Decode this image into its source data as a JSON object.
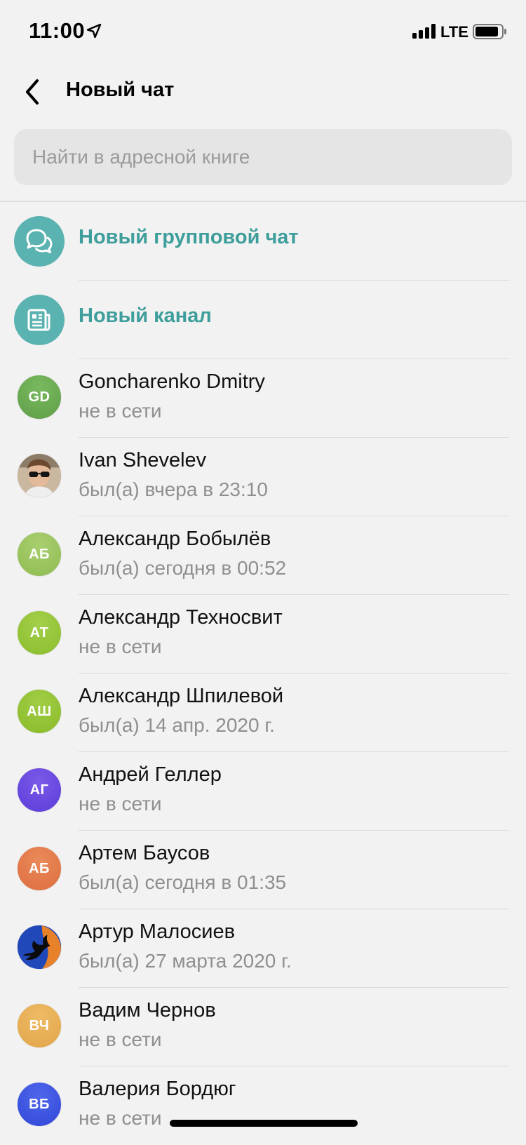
{
  "status_bar": {
    "time": "11:00",
    "network": "LTE",
    "icons": [
      "location-arrow-icon",
      "signal-icon",
      "battery-icon"
    ]
  },
  "nav": {
    "back_icon": "chevron-left-icon",
    "title": "Новый чат"
  },
  "search": {
    "placeholder": "Найти в адресной книге",
    "value": ""
  },
  "actions": [
    {
      "label": "Новый групповой чат",
      "icon": "chat-bubbles-icon"
    },
    {
      "label": "Новый канал",
      "icon": "newspaper-icon"
    }
  ],
  "contacts": [
    {
      "name": "Goncharenko Dmitry",
      "status": "не в сети",
      "initials": "GD",
      "color": "#5f9e47",
      "color2": "#79b95f"
    },
    {
      "name": "Ivan Shevelev",
      "status": "был(а) вчера в 23:10",
      "initials": "",
      "photo": true
    },
    {
      "name": "Александр Бобылёв",
      "status": "был(а) сегодня в 00:52",
      "initials": "АБ",
      "color": "#8fbb52",
      "color2": "#a9cf6f"
    },
    {
      "name": "Александр Техносвит",
      "status": "не в сети",
      "initials": "АТ",
      "color": "#8bbd2e",
      "color2": "#a3cf4a"
    },
    {
      "name": "Александр Шпилевой",
      "status": "был(а) 14 апр. 2020 г.",
      "initials": "АШ",
      "color": "#89bb2a",
      "color2": "#a1cd45"
    },
    {
      "name": "Андрей Геллер",
      "status": "не в сети",
      "initials": "АГ",
      "color": "#5b3cd8",
      "color2": "#7a5ae8"
    },
    {
      "name": "Артем Баусов",
      "status": "был(а) сегодня в 01:35",
      "initials": "АБ",
      "color": "#dd6d3f",
      "color2": "#ea8a5a"
    },
    {
      "name": "Артур Малосиев",
      "status": "был(а) 27 марта 2020 г.",
      "initials": "",
      "logo": true
    },
    {
      "name": "Вадим Чернов",
      "status": "не в сети",
      "initials": "ВЧ",
      "color": "#e2a54a",
      "color2": "#eebb65"
    },
    {
      "name": "Валерия Бордюг",
      "status": "не в сети",
      "initials": "ВБ",
      "color": "#3047d8",
      "color2": "#4f66ea"
    }
  ]
}
